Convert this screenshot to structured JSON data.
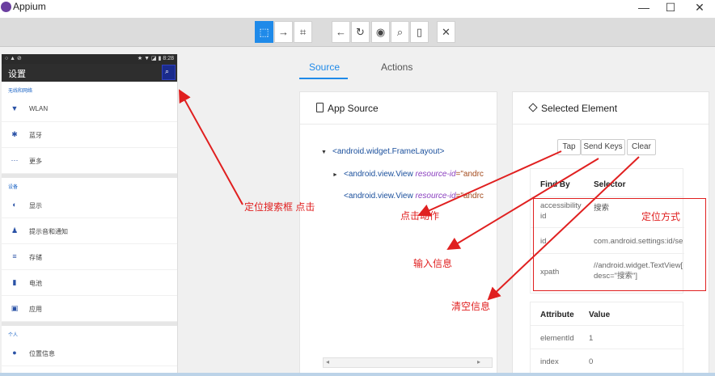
{
  "window": {
    "title": "Appium",
    "minimize": "—",
    "maximize": "☐",
    "close": "✕"
  },
  "toolbar": {
    "buttons": [
      {
        "name": "select-elements-icon",
        "glyph": "⬚"
      },
      {
        "name": "swipe-icon",
        "glyph": "→"
      },
      {
        "name": "tap-coordinates-icon",
        "glyph": "⌗"
      },
      {
        "name": "back-icon",
        "glyph": "←"
      },
      {
        "name": "refresh-icon",
        "glyph": "↻"
      },
      {
        "name": "eye-icon",
        "glyph": "◉"
      },
      {
        "name": "search-icon",
        "glyph": "⌕"
      },
      {
        "name": "copy-icon",
        "glyph": "▯"
      },
      {
        "name": "close-icon",
        "glyph": "✕"
      }
    ]
  },
  "device": {
    "status_left": "○ ▲ ⊘",
    "status_right": "★ ▼ ◪ ▮ 8:28",
    "title": "设置",
    "search_glyph": "⌕",
    "sections": [
      {
        "header": "无线和网络",
        "items": [
          {
            "icon": "▼",
            "label": "WLAN"
          },
          {
            "icon": "✱",
            "label": "蓝牙"
          },
          {
            "icon": "···",
            "label": "更多"
          }
        ]
      },
      {
        "header": "设备",
        "items": [
          {
            "icon": "◐",
            "label": "显示"
          },
          {
            "icon": "♟",
            "label": "提示音和通知"
          },
          {
            "icon": "≡",
            "label": "存储"
          },
          {
            "icon": "▮",
            "label": "电池"
          },
          {
            "icon": "▣",
            "label": "应用"
          }
        ]
      },
      {
        "header": "个人",
        "items": [
          {
            "icon": "●",
            "label": "位置信息"
          }
        ]
      }
    ]
  },
  "inspector": {
    "tabs": [
      "Source",
      "Actions"
    ],
    "source_title": "App Source",
    "tree": [
      {
        "toggle": "▼",
        "tag": "<android.widget.FrameLayout>",
        "attr": "",
        "val": ""
      },
      {
        "toggle": "►",
        "tag": "<android.view.View ",
        "attr": "resource-id",
        "val": "=\"andrc"
      },
      {
        "toggle": "",
        "tag": "<android.view.View ",
        "attr": "resource-id",
        "val": "=\"andrc"
      }
    ],
    "selected_title": "Selected Element",
    "actions": [
      "Tap",
      "Send Keys",
      "Clear"
    ],
    "selector_table": {
      "headers": [
        "Find By",
        "Selector"
      ],
      "rows": [
        {
          "by": "accessibility id",
          "sel": "搜索"
        },
        {
          "by": "id",
          "sel": "com.android.settings:id/searc"
        },
        {
          "by": "xpath",
          "sel": "//android.widget.TextView[@c desc=\"搜索\"]"
        }
      ]
    },
    "attr_table": {
      "headers": [
        "Attribute",
        "Value"
      ],
      "rows": [
        {
          "name": "elementId",
          "value": "1"
        },
        {
          "name": "index",
          "value": "0"
        }
      ]
    }
  },
  "annotations": {
    "locate_search": "定位搜索框 点击",
    "tap_action": "点击动作",
    "input_info": "输入信息",
    "clear_info": "清空信息",
    "locate_method": "定位方式"
  },
  "colors": {
    "accent": "#1f8ae9",
    "annotation": "#e02020"
  }
}
